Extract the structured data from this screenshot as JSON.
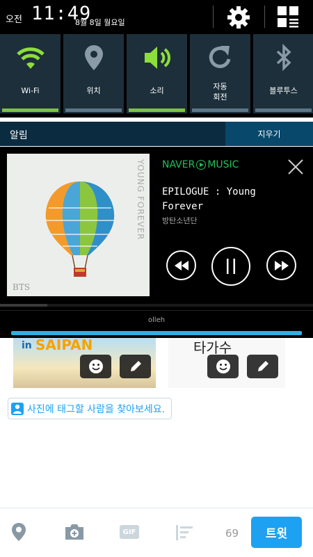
{
  "status": {
    "ampm": "오전",
    "time": "11:49",
    "date": "8월 8일 월요일"
  },
  "quick_settings": [
    {
      "label": "Wi-Fi",
      "icon": "wifi-icon",
      "active": true
    },
    {
      "label": "위치",
      "icon": "location-pin-icon",
      "active": false
    },
    {
      "label": "소리",
      "icon": "speaker-icon",
      "active": true
    },
    {
      "label": "자동\n회전",
      "icon": "rotate-icon",
      "active": false
    },
    {
      "label": "블루투스",
      "icon": "bluetooth-icon",
      "active": false
    }
  ],
  "notifications": {
    "title": "알림",
    "clear_label": "지우기"
  },
  "music": {
    "brand_left": "NAVER",
    "brand_right": "MUSIC",
    "song": "EPILOGUE : Young Forever",
    "artist": "방탄소년단",
    "album_art_title": "YOUNG FOREVER",
    "album_art_band": "BTS",
    "progress": 0.15
  },
  "carrier": "olleh",
  "thumbnails": [
    {
      "text_a": "in",
      "text_b": "SAIPAN"
    },
    {
      "text_a": "타가수"
    }
  ],
  "tag_prompt": "사진에 태그할 사람을 찾아보세요.",
  "toolbar": {
    "char_count": "69",
    "tweet_label": "트윗",
    "gif_label": "GIF"
  },
  "colors": {
    "accent": "#1da1f2",
    "toggle_on": "#7dc341",
    "naver_green": "#21c05a"
  }
}
